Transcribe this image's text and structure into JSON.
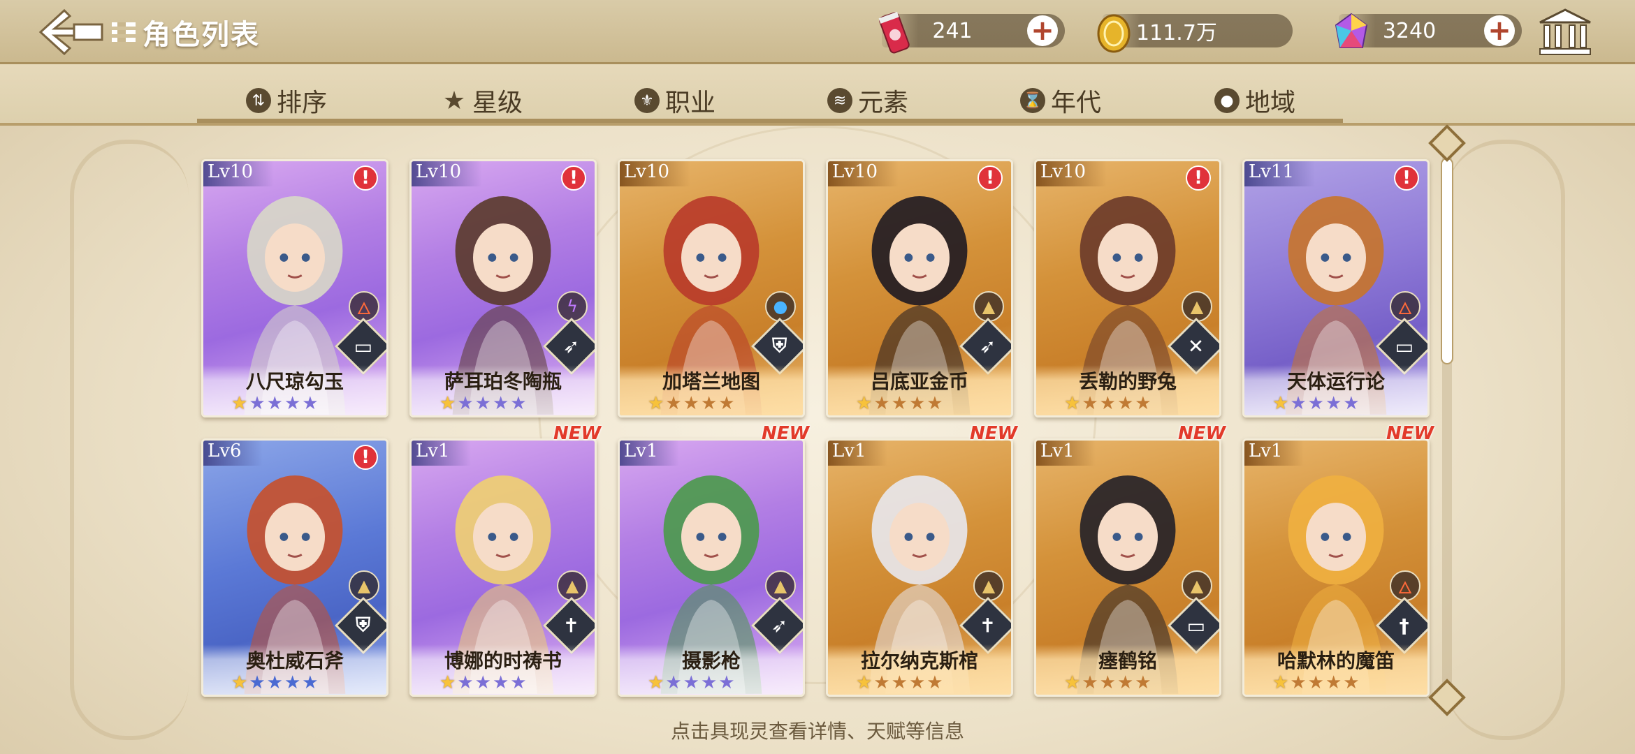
{
  "header": {
    "title": "角色列表",
    "resources": [
      {
        "name": "stamina",
        "icon": "soda-can-icon",
        "value": "241"
      },
      {
        "name": "gold",
        "icon": "gold-coin-icon",
        "value": "111.7万"
      },
      {
        "name": "gem",
        "icon": "rainbow-gem-icon",
        "value": "3240"
      }
    ]
  },
  "filters": [
    {
      "label": "排序",
      "icon": "sort-icon"
    },
    {
      "label": "星级",
      "icon": "star-icon"
    },
    {
      "label": "职业",
      "icon": "class-icon"
    },
    {
      "label": "元素",
      "icon": "element-icon"
    },
    {
      "label": "年代",
      "icon": "era-icon"
    },
    {
      "label": "地域",
      "icon": "location-pin-icon"
    }
  ],
  "cards": [
    {
      "level": "Lv10",
      "name": "八尺琼勾玉",
      "rarity": "purple",
      "stars": 1,
      "alert": true,
      "new": false,
      "element": "fire",
      "job": "book"
    },
    {
      "level": "Lv10",
      "name": "萨耳珀冬陶瓶",
      "rarity": "purple",
      "stars": 1,
      "alert": true,
      "new": false,
      "element": "lightning",
      "job": "dart"
    },
    {
      "level": "Lv10",
      "name": "加塔兰地图",
      "rarity": "gold",
      "stars": 1,
      "alert": false,
      "new": false,
      "element": "water",
      "job": "shield"
    },
    {
      "level": "Lv10",
      "name": "吕底亚金币",
      "rarity": "gold",
      "stars": 1,
      "alert": true,
      "new": false,
      "element": "earth",
      "job": "dart"
    },
    {
      "level": "Lv10",
      "name": "丢勒的野兔",
      "rarity": "gold",
      "stars": 1,
      "alert": true,
      "new": false,
      "element": "earth",
      "job": "swords"
    },
    {
      "level": "Lv11",
      "name": "天体运行论",
      "rarity": "violet",
      "stars": 1,
      "alert": true,
      "new": false,
      "element": "fire",
      "job": "book"
    },
    {
      "level": "Lv6",
      "name": "奥杜威石斧",
      "rarity": "blue",
      "stars": 1,
      "alert": true,
      "new": false,
      "element": "earth",
      "job": "shield"
    },
    {
      "level": "Lv1",
      "name": "博娜的时祷书",
      "rarity": "purple",
      "stars": 1,
      "alert": false,
      "new": true,
      "element": "earth",
      "job": "cross"
    },
    {
      "level": "Lv1",
      "name": "摄影枪",
      "rarity": "purple",
      "stars": 1,
      "alert": false,
      "new": true,
      "element": "earth",
      "job": "dart"
    },
    {
      "level": "Lv1",
      "name": "拉尔纳克斯棺",
      "rarity": "gold",
      "stars": 1,
      "alert": false,
      "new": true,
      "element": "earth",
      "job": "cross"
    },
    {
      "level": "Lv1",
      "name": "瘗鹤铭",
      "rarity": "gold",
      "stars": 1,
      "alert": false,
      "new": true,
      "element": "earth",
      "job": "book"
    },
    {
      "level": "Lv1",
      "name": "哈默林的魔笛",
      "rarity": "gold",
      "stars": 1,
      "alert": false,
      "new": true,
      "element": "fire",
      "job": "sword"
    }
  ],
  "new_label": "NEW",
  "alert_label": "!",
  "hint": "点击具现灵查看详情、天赋等信息"
}
